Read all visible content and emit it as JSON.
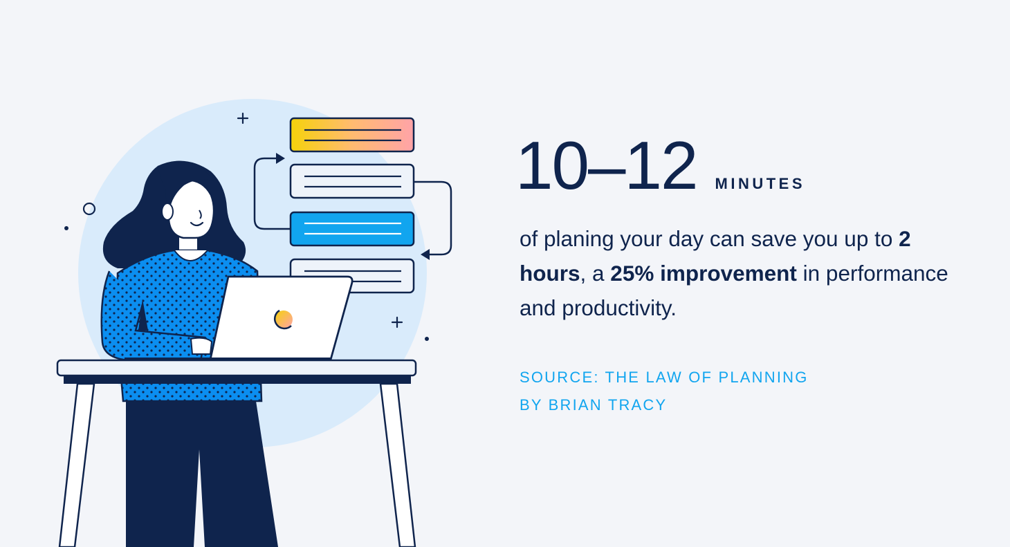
{
  "stat": {
    "number": "10–12",
    "unit": "MINUTES"
  },
  "description": {
    "part1": "of planing your day can save you up to ",
    "bold1": "2 hours",
    "part2": ", a ",
    "bold2": "25% improvement",
    "part3": " in performance and productivity."
  },
  "source": {
    "line1": "SOURCE: THE LAW OF PLANNING",
    "line2": "BY BRIAN TRACY"
  },
  "colors": {
    "background": "#f3f5f9",
    "navy": "#0f244d",
    "accent_blue": "#11a5ef",
    "circle_light_blue": "#d9ebfb",
    "shirt_blue": "#0b8ef0",
    "card_yellow": "#f5d20a",
    "card_pink": "#ffa3a8"
  },
  "icons": {
    "laptop_logo": "circle-logo-icon",
    "arrow_left": "arrow-right-icon",
    "arrow_right": "arrow-left-icon",
    "plus_1": "plus-icon",
    "plus_2": "plus-icon"
  }
}
